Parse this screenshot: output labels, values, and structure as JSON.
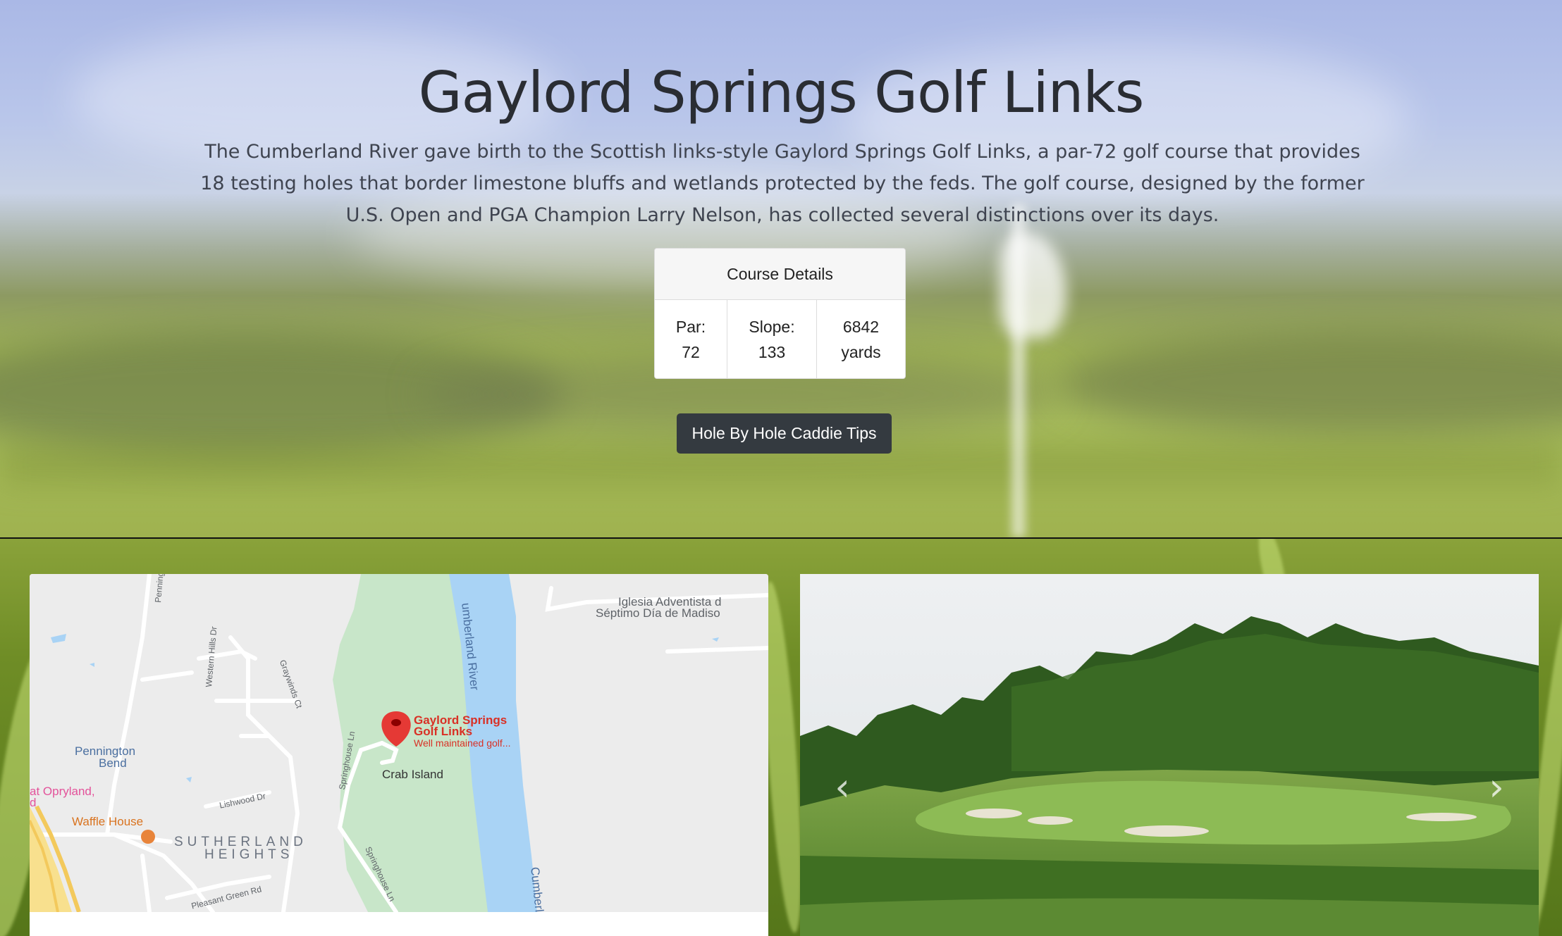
{
  "hero": {
    "title": "Gaylord Springs Golf Links",
    "description": "The Cumberland River gave birth to the Scottish links-style Gaylord Springs Golf Links, a par-72 golf course that provides 18 testing holes that border limestone bluffs and wetlands protected by the feds. The golf course, designed by the former U.S. Open and PGA Champion Larry Nelson, has collected several distinctions over its days."
  },
  "course_details": {
    "header": "Course Details",
    "par_label": "Par:",
    "par_value": "72",
    "slope_label": "Slope:",
    "slope_value": "133",
    "yards_value": "6842",
    "yards_label": "yards"
  },
  "caddie_button": {
    "label": "Hole By Hole Caddie Tips"
  },
  "map": {
    "labels": {
      "church_line1": "Iglesia Adventista d",
      "church_line2": "Séptimo Día de Madiso",
      "river_top": "umberland River",
      "river_bottom": "Cumberlan",
      "pennington_bend_rd": "Pennington Bend Rd",
      "western_hills_dr": "Western Hills Dr",
      "graywinds_ct": "Graywinds Ct",
      "pin_title_line1": "Gaylord Springs",
      "pin_title_line2": "Golf Links",
      "pin_subtitle": "Well maintained golf...",
      "crab_island": "Crab Island",
      "pennington_bend_line1": "Pennington",
      "pennington_bend_line2": "Bend",
      "opryland_line1": "at Opryland,",
      "opryland_line2": "d",
      "waffle_house": "Waffle House",
      "lishwood_dr": "Lishwood Dr",
      "springhouse_ln_1": "Springhouse Ln",
      "springhouse_ln_2": "Springhouse Ln",
      "sutherland_line1": "SUTHERLAND",
      "sutherland_line2": "HEIGHTS",
      "pleasant_green_rd": "Pleasant Green Rd"
    }
  },
  "carousel": {
    "prev_icon": "chevron-left-icon",
    "next_icon": "chevron-right-icon"
  },
  "colors": {
    "button_bg": "#343a40",
    "map_park": "#c8e6c9",
    "map_water": "#a9d3f5",
    "pin_red": "#e53935",
    "map_road_label": "#5f6368",
    "waffle_orange": "#e8843a"
  }
}
